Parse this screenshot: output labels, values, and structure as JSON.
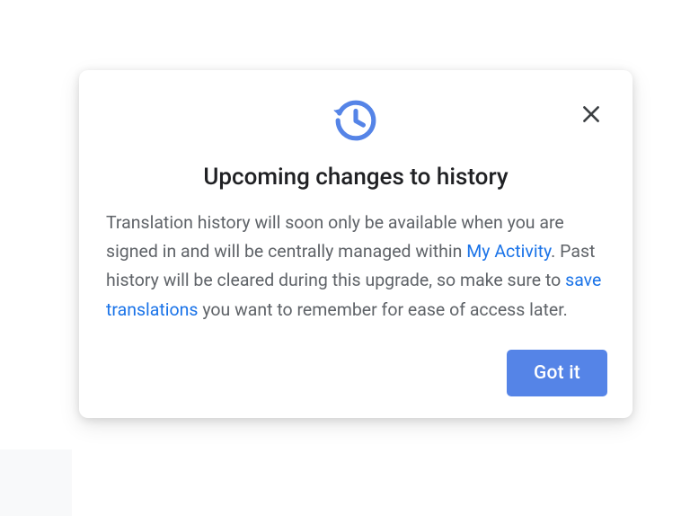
{
  "dialog": {
    "title": "Upcoming changes to history",
    "body": {
      "segment1": "Translation history will soon only be available when you are signed in and will be centrally managed within ",
      "link1": "My Activity",
      "segment2": ". Past history will be cleared during this upgrade, so make sure to ",
      "link2": "save translations",
      "segment3": " you want to remember for ease of access later."
    },
    "confirm_label": "Got it"
  }
}
